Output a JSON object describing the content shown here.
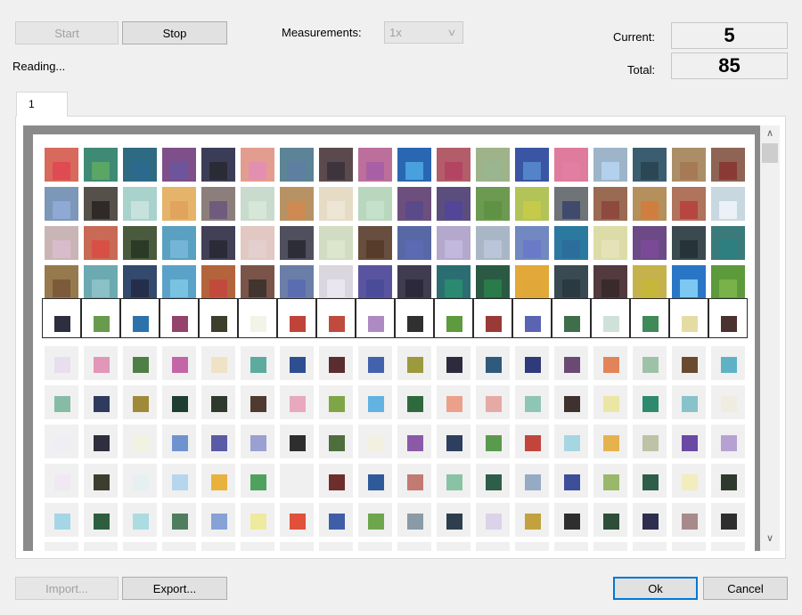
{
  "toolbar": {
    "start_label": "Start",
    "stop_label": "Stop",
    "measurements_label": "Measurements:",
    "measurements_value": "1x"
  },
  "status": {
    "text": "Reading..."
  },
  "counters": {
    "current_label": "Current:",
    "current_value": "5",
    "total_label": "Total:",
    "total_value": "85"
  },
  "tabs": [
    {
      "label": "1"
    }
  ],
  "footer": {
    "import_label": "Import...",
    "export_label": "Export...",
    "ok_label": "Ok",
    "cancel_label": "Cancel"
  },
  "icons": {
    "combo_arrow": "chevron-down-icon",
    "scroll_up": "scroll-up-icon",
    "scroll_down": "scroll-down-icon"
  },
  "colors": {
    "accent": "#0078d7",
    "measured_rows": [
      [
        [
          "#d76a5c",
          "#e04a52"
        ],
        [
          "#3f8a74",
          "#5ba565"
        ],
        [
          "#2e6b82",
          "#2b6a8e"
        ],
        [
          "#7f4f8a",
          "#6c559a"
        ],
        [
          "#3b3d58",
          "#2a2b34"
        ],
        [
          "#e39d8e",
          "#e48fb0"
        ],
        [
          "#5c8396",
          "#5e7fa2"
        ],
        [
          "#5b4a4d",
          "#3e343d"
        ],
        [
          "#bd6f9c",
          "#a95fa6"
        ],
        [
          "#2a67b2",
          "#48a0dc"
        ],
        [
          "#b45d6a",
          "#b34562"
        ],
        [
          "#9eb38a",
          "#9ab690"
        ],
        [
          "#3955a3",
          "#5383c8"
        ],
        [
          "#df7b9c",
          "#e17ea2"
        ],
        [
          "#9eb4c8",
          "#b3d1ec"
        ],
        [
          "#3a5e6f",
          "#2b4756"
        ],
        [
          "#ab8e68",
          "#a67a55"
        ],
        [
          "#8e6454",
          "#8a3a34"
        ]
      ],
      [
        [
          "#7c97b8",
          "#8ea9d4"
        ],
        [
          "#555049",
          "#2f2927"
        ],
        [
          "#a8d2cc",
          "#c7e2dc"
        ],
        [
          "#e5b46a",
          "#e0a45c"
        ],
        [
          "#8c7e7b",
          "#6f5c7c"
        ],
        [
          "#c8dbcd",
          "#d6e6d8"
        ],
        [
          "#b79364",
          "#cf8a52"
        ],
        [
          "#e6dbc5",
          "#ede6d5"
        ],
        [
          "#b8d7bd",
          "#c6e1cb"
        ],
        [
          "#6d4f7e",
          "#5a4a8a"
        ],
        [
          "#5b4e7e",
          "#534597"
        ],
        [
          "#6b9a50",
          "#5f9243"
        ],
        [
          "#b2c357",
          "#c6ca4a"
        ],
        [
          "#6e7477",
          "#3f4a6d"
        ],
        [
          "#9a6a52",
          "#8e4a3e"
        ],
        [
          "#b58f5c",
          "#cf7e40"
        ],
        [
          "#b0735c",
          "#b74640"
        ],
        [
          "#c8d8e0",
          "#eaf1f7"
        ]
      ],
      [
        [
          "#c9b5b6",
          "#d9bccb"
        ],
        [
          "#c86a55",
          "#d85045"
        ],
        [
          "#4a5a3c",
          "#2a3a26"
        ],
        [
          "#5aa0c0",
          "#74b4d6"
        ],
        [
          "#414057",
          "#2b2b38"
        ],
        [
          "#e1c8c2",
          "#e4cfcf"
        ],
        [
          "#4f4f5e",
          "#2d2d38"
        ],
        [
          "#d1dcc2",
          "#dbe6cc"
        ],
        [
          "#684e3e",
          "#573b2b"
        ],
        [
          "#5868a4",
          "#5b6ab2"
        ],
        [
          "#b4a8cc",
          "#c2b7dc"
        ],
        [
          "#a9b6c6",
          "#bbc5d9"
        ],
        [
          "#7189c0",
          "#6a7ac8"
        ],
        [
          "#2c79a0",
          "#2c6d9c"
        ],
        [
          "#dcdca8",
          "#e6e2b8"
        ],
        [
          "#6c4a86",
          "#7a4a98"
        ],
        [
          "#3a4a4e",
          "#27333a"
        ],
        [
          "#3a7a7a",
          "#2e8080"
        ]
      ],
      [
        [
          "#967a4e",
          "#7c5a3a"
        ],
        [
          "#6aaab0",
          "#8ac0c6"
        ],
        [
          "#33496e",
          "#242e4a"
        ],
        [
          "#5aa2c8",
          "#7ac2e2"
        ],
        [
          "#b4643c",
          "#c24a3c"
        ],
        [
          "#7a5448",
          "#42342e"
        ],
        [
          "#6a7ea8",
          "#5b6db0"
        ],
        [
          "#dad6de",
          "#e9e6ef"
        ],
        [
          "#5a54a0",
          "#4a4c9a"
        ],
        [
          "#3f3c50",
          "#2a2a3a"
        ],
        [
          "#2a6e72",
          "#2a8a70"
        ],
        [
          "#2a5a44",
          "#2a7a4a"
        ],
        [
          "#e2a83a",
          "#e0a838"
        ],
        [
          "#3a4a52",
          "#2a3a40"
        ],
        [
          "#523a3e",
          "#3a2a2e"
        ],
        [
          "#c6b24c",
          "#c6b63a"
        ],
        [
          "#2a76c6",
          "#7cc8f2"
        ],
        [
          "#5c9a3c",
          "#78b248"
        ]
      ]
    ],
    "current_row": [
      "#2d2e3e",
      "#6a9a4e",
      "#2e72ac",
      "#94436a",
      "#3e3e2c",
      "#f2f4e8",
      "#c0433a",
      "#c04a3e",
      "#ae8ac2",
      "#303030",
      "#5e9a3e",
      "#9a3a36",
      "#5a64b2",
      "#3e6e4a",
      "#cfe2d9",
      "#3f8a58",
      "#e5dca4",
      "#4a3230"
    ],
    "pending_rows": [
      [
        "#e7def0",
        "#e297b8",
        "#4e7f45",
        "#c466a6",
        "#f0e2c6",
        "#5cab9e",
        "#2e4e92",
        "#5a2e2e",
        "#4262ae",
        "#9c9a3e",
        "#2e2a3e",
        "#2e5a7e",
        "#2e3a7a",
        "#6a4a72",
        "#e2845a",
        "#9ec2a8",
        "#6a4a2e",
        "#5eb2c6"
      ],
      [
        "#86bca6",
        "#2e3a5e",
        "#a08a3a",
        "#1e3e32",
        "#2e3a2e",
        "#4e3a2e",
        "#e8a8be",
        "#7ea646",
        "#62b2e2",
        "#2e6a3e",
        "#eca08a",
        "#e6aaa6",
        "#8ec6b6",
        "#3e322e",
        "#ece6a4",
        "#2e8a6e",
        "#88c2ca",
        "#f0ece0"
      ],
      [
        "#eeeef4",
        "#2e2e3e",
        "#f2f2e0",
        "#6e94d0",
        "#5a5aa6",
        "#9aa0d2",
        "#2e2e2e",
        "#4e6e3e",
        "#f2f0e0",
        "#8a5aa6",
        "#2e3e5e",
        "#5a9a4e",
        "#c2443a",
        "#a6d6e2",
        "#e6b24e",
        "#bec2a6",
        "#6a4aa2",
        "#b6a2d2"
      ],
      [
        "#f0e8f2",
        "#3e3e2e",
        "#e6f0f2",
        "#b6d6ee",
        "#e8b23e",
        "#4ea25e",
        "#f0f0f0",
        "#6e2e2e",
        "#2e5a9a",
        "#c27a72",
        "#8ac2a6",
        "#2e5e4a",
        "#96aac6",
        "#3e4e9a",
        "#9ab86a",
        "#2e5e4a",
        "#f2ecbe",
        "#2e3a2e"
      ],
      [
        "#a4d6e8",
        "#2e5e3e",
        "#aadce2",
        "#4e7e5e",
        "#86a2d6",
        "#eeea9e",
        "#e0503a",
        "#3e5ea8",
        "#6ea64e",
        "#8a9aa6",
        "#2e3e4e",
        "#dcd2ea",
        "#c2a23e",
        "#2e2e2e",
        "#2e4e3a",
        "#2e2e4e",
        "#a88a8a",
        "#2e2e2e"
      ],
      [
        "#eaeaea",
        "#eaeaea",
        "#eaeaea",
        "#eaeaea",
        "#eaeaea",
        "#eaeaea",
        "#eaeaea",
        "#eaeaea",
        "#eaeaea",
        "#eaeaea",
        "#eaeaea",
        "#eaeaea",
        "#eaeaea",
        "#eaeaea",
        "#eaeaea",
        "#eaeaea",
        "#eaeaea",
        "#eaeaea"
      ]
    ]
  }
}
